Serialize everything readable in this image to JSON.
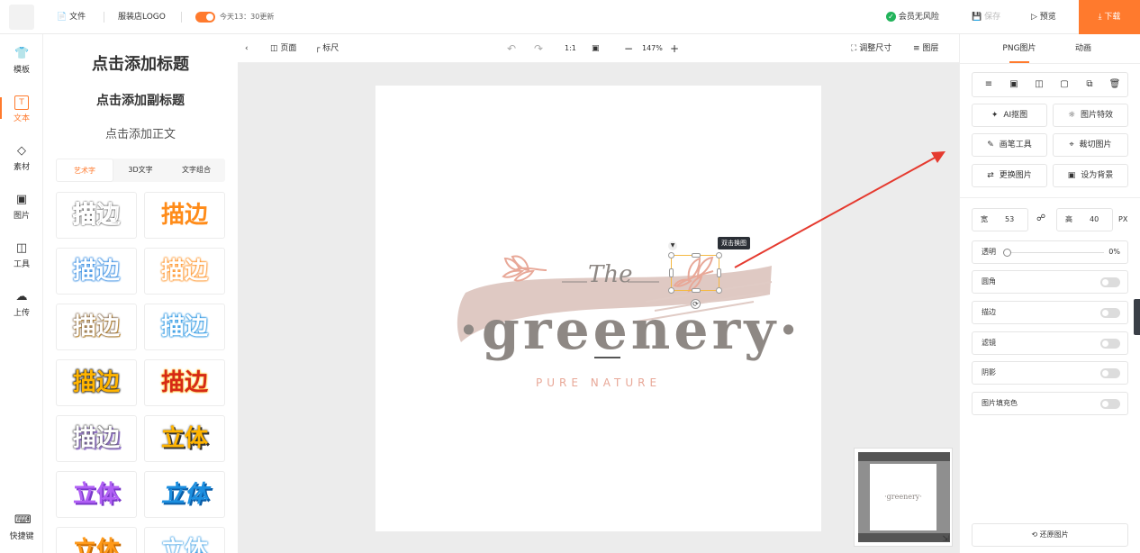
{
  "topbar": {
    "file_label": "文件",
    "doc_name": "服装店LOGO",
    "autosave_text": "今天13：30更新",
    "member_label": "会员无风险",
    "save_label": "保存",
    "preview_label": "预览",
    "download_label": "下载"
  },
  "leftnav": {
    "items": [
      {
        "label": "模板",
        "icon": "shirt-icon"
      },
      {
        "label": "文本",
        "icon": "text-icon"
      },
      {
        "label": "素材",
        "icon": "shapes-icon"
      },
      {
        "label": "图片",
        "icon": "image-icon"
      },
      {
        "label": "工具",
        "icon": "toolbox-icon"
      },
      {
        "label": "上传",
        "icon": "cloud-upload-icon"
      }
    ],
    "shortcuts_label": "快捷键"
  },
  "text_panel": {
    "add_title": "点击添加标题",
    "add_subtitle": "点击添加副标题",
    "add_body": "点击添加正文",
    "tabs": [
      "艺术字",
      "3D文字",
      "文字组合"
    ],
    "tiles": [
      "描边",
      "描边",
      "描边",
      "描边",
      "描边",
      "描边",
      "描边",
      "描边",
      "描边",
      "立体",
      "立体",
      "立体",
      "立体",
      "立体"
    ]
  },
  "canvas_toolbar": {
    "page_label": "页面",
    "ruler_label": "标尺",
    "ratio_label": "1:1",
    "zoom": "147%",
    "resize_label": "调整尺寸",
    "layers_label": "图层"
  },
  "canvas": {
    "the_text": "The",
    "main_text": "·greenery·",
    "sub_text": "PURE NATURE",
    "tooltip": "双击换图"
  },
  "minimap": {
    "text": "·greenery·"
  },
  "right_panel": {
    "tabs": [
      "PNG图片",
      "动画"
    ],
    "ai_cutout": "AI抠图",
    "image_effect": "图片特效",
    "brush_tool": "画笔工具",
    "crop_image": "裁切图片",
    "replace_image": "更换图片",
    "set_background": "设为背景",
    "width_label": "宽",
    "width_value": "53",
    "height_label": "高",
    "height_value": "40",
    "unit": "PX",
    "opacity_label": "透明",
    "opacity_value": "0%",
    "props": [
      "圆角",
      "描边",
      "滤镜",
      "阴影",
      "图片填充色"
    ],
    "restore_label": "还原图片"
  },
  "colors": {
    "accent": "#ff7a2d",
    "leaf": "#e8a898",
    "text_brown": "#8e8884",
    "brush": "#d9bfb8",
    "selection": "#f5b942",
    "arrow": "#e53a2f"
  }
}
